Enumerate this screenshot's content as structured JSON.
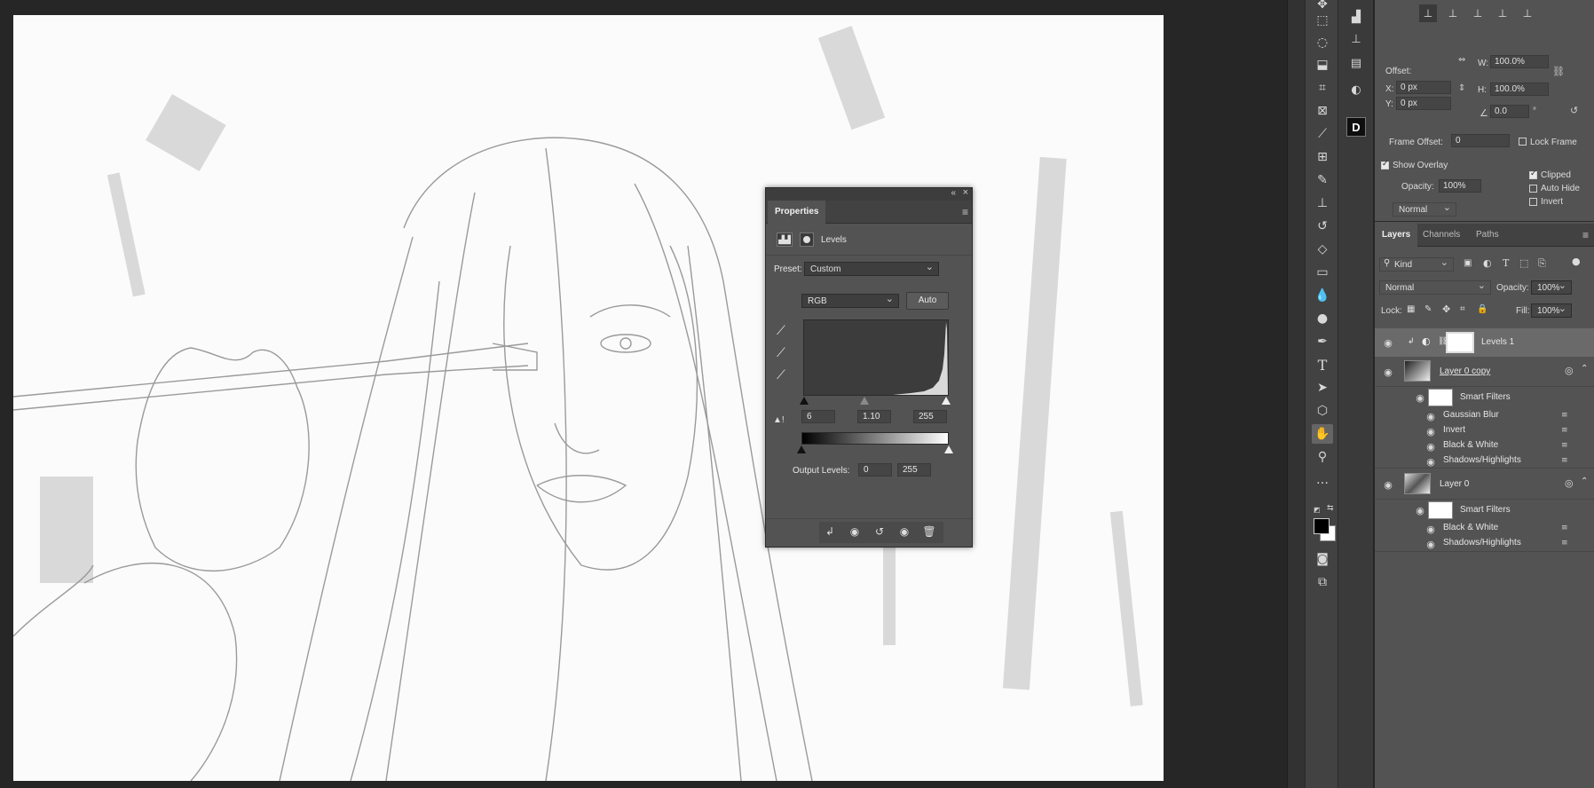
{
  "properties": {
    "tab": "Properties",
    "adjustment": "Levels",
    "preset_label": "Preset:",
    "preset_value": "Custom",
    "channel": "RGB",
    "auto_label": "Auto",
    "input_black": "6",
    "input_gamma": "1.10",
    "input_white": "255",
    "output_label": "Output Levels:",
    "output_black": "0",
    "output_white": "255"
  },
  "clone_source": {
    "offset_label": "Offset:",
    "x_label": "X:",
    "x_value": "0 px",
    "y_label": "Y:",
    "y_value": "0 px",
    "w_label": "W:",
    "w_value": "100.0%",
    "h_label": "H:",
    "h_value": "100.0%",
    "angle_value": "0.0",
    "angle_unit": "°",
    "frame_offset_label": "Frame Offset:",
    "frame_offset_value": "0",
    "lock_frame": "Lock Frame",
    "show_overlay": "Show Overlay",
    "opacity_label": "Opacity:",
    "opacity_value": "100%",
    "blend_mode": "Normal",
    "clipped": "Clipped",
    "auto_hide": "Auto Hide",
    "invert": "Invert"
  },
  "layers_panel": {
    "tabs": [
      "Layers",
      "Channels",
      "Paths"
    ],
    "filter_kind": "Kind",
    "blend_mode": "Normal",
    "opacity_label": "Opacity:",
    "opacity_value": "100%",
    "lock_label": "Lock:",
    "fill_label": "Fill:",
    "fill_value": "100%",
    "layers": [
      {
        "name": "Levels 1"
      },
      {
        "name": "Layer 0 copy",
        "smart_filters": "Smart Filters",
        "filters": [
          "Gaussian Blur",
          "Invert",
          "Black & White",
          "Shadows/Highlights"
        ]
      },
      {
        "name": "Layer 0",
        "smart_filters": "Smart Filters",
        "filters": [
          "Black & White",
          "Shadows/Highlights"
        ]
      }
    ]
  },
  "histogram": {
    "peak_position": "right",
    "black_point": 6,
    "gamma": 1.1,
    "white_point": 255
  }
}
